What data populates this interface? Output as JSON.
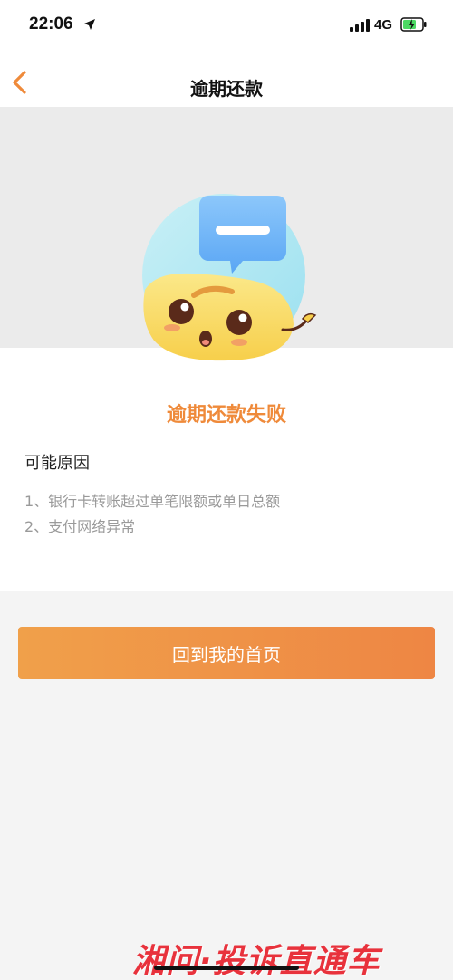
{
  "status_bar": {
    "time": "22:06",
    "network": "4G",
    "icons": [
      "location-arrow-icon",
      "signal-icon",
      "battery-charging-icon"
    ]
  },
  "nav": {
    "title": "逾期还款",
    "back_icon": "chevron-left-icon",
    "accent": "#ef8a3a"
  },
  "result": {
    "title": "逾期还款失败",
    "title_color": "#ef8a3a"
  },
  "reasons": {
    "heading": "可能原因",
    "items": [
      "1、银行卡转账超过单笔限额或单日总额",
      "2、支付网络异常"
    ]
  },
  "actions": {
    "home_label": "回到我的首页",
    "gradient": [
      "#f0a04a",
      "#ee8644"
    ]
  },
  "watermark": {
    "text": "湘问·投诉直通车",
    "color": "#e8323c"
  }
}
